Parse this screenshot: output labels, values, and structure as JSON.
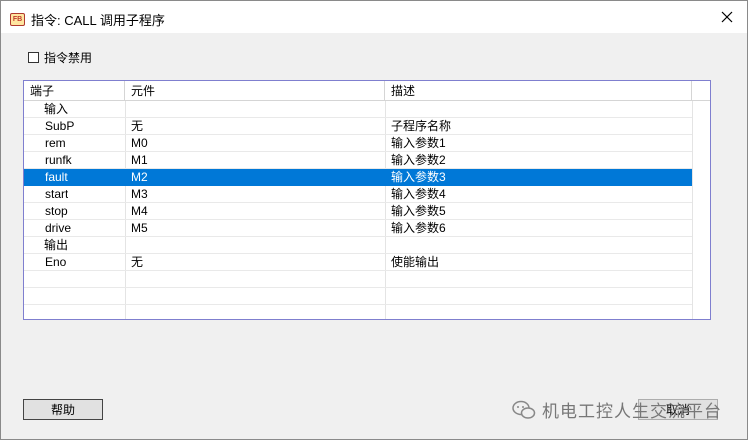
{
  "window": {
    "title": "指令: CALL 调用子程序",
    "icon_text": "FB"
  },
  "disable_checkbox": {
    "label": "指令禁用",
    "checked": false
  },
  "table": {
    "headers": [
      "端子",
      "元件",
      "描述"
    ],
    "rows": [
      {
        "port": "输入",
        "element": "",
        "desc": "",
        "group": true
      },
      {
        "port": "SubP",
        "element": "无",
        "desc": "子程序名称"
      },
      {
        "port": "rem",
        "element": "M0",
        "desc": "输入参数1"
      },
      {
        "port": "runfk",
        "element": "M1",
        "desc": "输入参数2"
      },
      {
        "port": "fault",
        "element": "M2",
        "desc": "输入参数3",
        "selected": true
      },
      {
        "port": "start",
        "element": "M3",
        "desc": "输入参数4"
      },
      {
        "port": "stop",
        "element": "M4",
        "desc": "输入参数5"
      },
      {
        "port": "drive",
        "element": "M5",
        "desc": "输入参数6"
      },
      {
        "port": "输出",
        "element": "",
        "desc": "",
        "group": true
      },
      {
        "port": "Eno",
        "element": "无",
        "desc": "使能输出"
      }
    ]
  },
  "buttons": {
    "help": "帮助",
    "cancel": "取消"
  },
  "watermark": {
    "text": "机电工控人生交流平台"
  },
  "colors": {
    "selection": "#0078d7",
    "grid_border": "#7f7fcf"
  }
}
